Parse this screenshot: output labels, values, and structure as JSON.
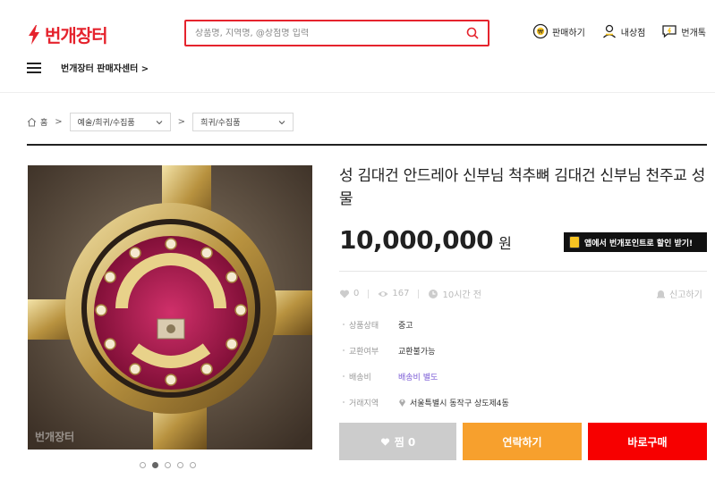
{
  "header": {
    "logo_text": "번개장터",
    "search_placeholder": "상품명, 지역명, @상점명 입력",
    "actions": [
      {
        "label": "판매하기",
        "icon": "won-circle-icon"
      },
      {
        "label": "내상점",
        "icon": "user-icon"
      },
      {
        "label": "번개톡",
        "icon": "chat-icon"
      }
    ],
    "seller_center": "번개장터 판매자센터 >"
  },
  "breadcrumb": {
    "home": "홈",
    "category1": "예술/희귀/수집품",
    "category2": "희귀/수집품"
  },
  "product": {
    "title": "성 김대건 안드레아 신부님 척추뼈 김대건 신부님 천주교 성물",
    "price": "10,000,000",
    "currency": "원",
    "app_banner": "앱에서 번개포인트로 할인 받기!",
    "likes": "0",
    "views": "167",
    "time_ago": "10시간 전",
    "report": "신고하기",
    "details": [
      {
        "label": "상품상태",
        "value": "중고"
      },
      {
        "label": "교환여부",
        "value": "교환불가능"
      },
      {
        "label": "배송비",
        "value": "배송비 별도"
      },
      {
        "label": "거래지역",
        "value": "서울특별시 동작구 상도제4동"
      }
    ],
    "image_watermark": "번개장터",
    "image_count": 5,
    "active_image_index": 1
  },
  "buttons": {
    "like": "찜 0",
    "contact": "연락하기",
    "buy": "바로구매"
  },
  "colors": {
    "brand": "#e5232d",
    "contact": "#f7a02d",
    "buy": "#f70000",
    "like": "#cccccc",
    "shipping_link": "#7b5cd6"
  }
}
